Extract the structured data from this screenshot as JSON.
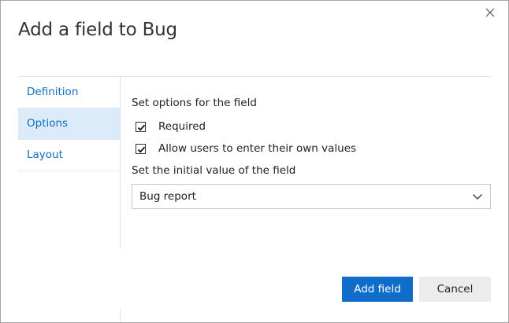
{
  "dialog": {
    "title": "Add a field to Bug",
    "close_icon": "close-icon"
  },
  "nav": {
    "items": [
      {
        "label": "Definition",
        "active": false
      },
      {
        "label": "Options",
        "active": true
      },
      {
        "label": "Layout",
        "active": false
      }
    ]
  },
  "options": {
    "section_label": "Set options for the field",
    "checkboxes": [
      {
        "label": "Required",
        "checked": true
      },
      {
        "label": "Allow users to enter their own values",
        "checked": true
      }
    ],
    "initial_value_label": "Set the initial value of the field",
    "initial_value": {
      "selected": "Bug report",
      "icon": "chevron-down-icon"
    }
  },
  "footer": {
    "primary_label": "Add field",
    "secondary_label": "Cancel"
  },
  "colors": {
    "accent": "#0f6cc8",
    "nav_link": "#106ebe",
    "nav_active_bg": "#dcebfa"
  }
}
